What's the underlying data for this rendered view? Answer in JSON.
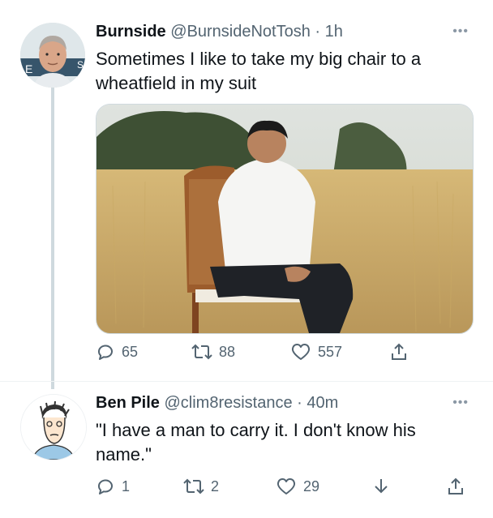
{
  "tweets": [
    {
      "name": "Burnside",
      "handle": "@BurnsideNotTosh",
      "separator": "·",
      "time": "1h",
      "text": "Sometimes I like to take my big chair to a wheatfield in my suit",
      "counts": {
        "reply": "65",
        "retweet": "88",
        "like": "557"
      },
      "has_image": true
    },
    {
      "name": "Ben Pile",
      "handle": "@clim8resistance",
      "separator": "·",
      "time": "40m",
      "text": "\"I have a man to carry it. I don't know his name.\"",
      "counts": {
        "reply": "1",
        "retweet": "2",
        "like": "29"
      },
      "has_image": false
    }
  ],
  "icons": {
    "reply": "reply-bubble-icon",
    "retweet": "retweet-icon",
    "like": "heart-icon",
    "share": "share-icon",
    "download": "download-arrow-icon",
    "more": "more-dots-icon"
  },
  "colors": {
    "text": "#0f1419",
    "secondary": "#536471",
    "thread_line": "#cfd9de"
  }
}
